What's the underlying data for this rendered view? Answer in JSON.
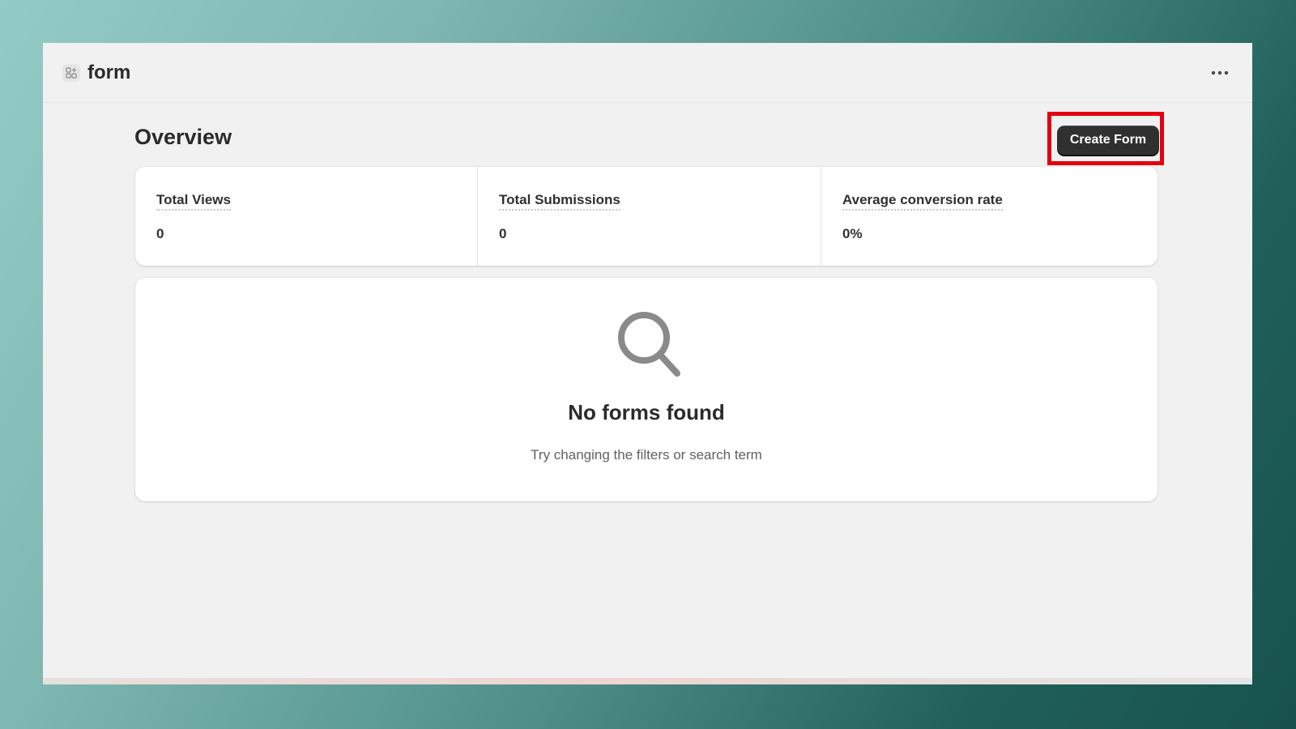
{
  "header": {
    "app_icon": "app-grid-icon",
    "title": "form",
    "more_icon": "ellipsis-icon"
  },
  "page": {
    "title": "Overview",
    "create_button_label": "Create Form",
    "highlight_color": "#e3000f"
  },
  "stats": [
    {
      "label": "Total Views",
      "value": "0"
    },
    {
      "label": "Total Submissions",
      "value": "0"
    },
    {
      "label": "Average conversion rate",
      "value": "0%"
    }
  ],
  "empty_state": {
    "icon": "search-icon",
    "title": "No forms found",
    "subtitle": "Try changing the filters or search term"
  },
  "colors": {
    "primary_button": "#303030",
    "surface": "#ffffff",
    "page_background": "#f1f1f1"
  }
}
